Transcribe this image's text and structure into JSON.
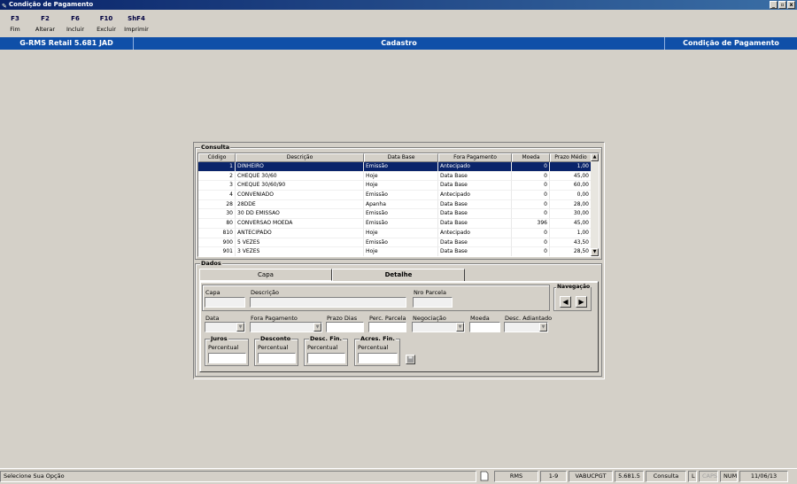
{
  "window": {
    "title": "Condição de Pagamento",
    "controls": [
      "_",
      "▫",
      "x"
    ]
  },
  "toolbar": [
    {
      "key": "F3",
      "label": "Fim"
    },
    {
      "key": "F2",
      "label": "Alterar"
    },
    {
      "key": "F6",
      "label": "Incluir"
    },
    {
      "key": "F10",
      "label": "Excluir"
    },
    {
      "key": "ShF4",
      "label": "Imprimir"
    }
  ],
  "infobar": {
    "app": "G-RMS Retail 5.681 JAD",
    "section": "Cadastro",
    "screen": "Condição de Pagamento"
  },
  "consulta": {
    "label": "Consulta",
    "columns": [
      "Código",
      "Descrição",
      "Data Base",
      "Fora Pagamento",
      "Moeda",
      "Prazo Médio"
    ],
    "rows": [
      [
        "1",
        "DINHEIRO",
        "Emissão",
        "Antecipado",
        "0",
        "1,00"
      ],
      [
        "2",
        "CHEQUE 30/60",
        "Hoje",
        "Data Base",
        "0",
        "45,00"
      ],
      [
        "3",
        "CHEQUE 30/60/90",
        "Hoje",
        "Data Base",
        "0",
        "60,00"
      ],
      [
        "4",
        "CONVENIADO",
        "Emissão",
        "Antecipado",
        "0",
        "0,00"
      ],
      [
        "28",
        "28DDE",
        "Apanha",
        "Data Base",
        "0",
        "28,00"
      ],
      [
        "30",
        "30 DD EMISSAO",
        "Emissão",
        "Data Base",
        "0",
        "30,00"
      ],
      [
        "80",
        "CONVERSAO MOEDA",
        "Emissão",
        "Data Base",
        "396",
        "45,00"
      ],
      [
        "810",
        "ANTECIPADO",
        "Hoje",
        "Antecipado",
        "0",
        "1,00"
      ],
      [
        "900",
        "5 VEZES",
        "Emissão",
        "Data Base",
        "0",
        "43,50"
      ],
      [
        "901",
        "3 VEZES",
        "Hoje",
        "Data Base",
        "0",
        "28,50"
      ]
    ]
  },
  "dados": {
    "label": "Dados",
    "tabs": [
      "Capa",
      "Detalhe"
    ],
    "fields": {
      "capa": "Capa",
      "descricao": "Descrição",
      "nro_parcela": "Nro Parcela",
      "data": "Data",
      "fora_pagamento": "Fora Pagamento",
      "prazo_dias": "Prazo Dias",
      "perc_parcela": "Perc. Parcela",
      "negociacao": "Negociação",
      "moeda": "Moeda",
      "desc_adiantado": "Desc. Adiantado"
    },
    "navegacao": "Navegação",
    "groups": [
      {
        "title": "Juros",
        "sub": "Percentual"
      },
      {
        "title": "Desconto",
        "sub": "Percentual"
      },
      {
        "title": "Desc. Fin.",
        "sub": "Percentual"
      },
      {
        "title": "Acres. Fin.",
        "sub": "Percentual"
      }
    ]
  },
  "status": {
    "message": "Selecione Sua Opção",
    "cells": [
      "RMS",
      "1-9",
      "VABUCPGT",
      "5.681.5",
      "Consulta",
      "L",
      "CAPS",
      "NUM",
      "11/06/13"
    ]
  }
}
